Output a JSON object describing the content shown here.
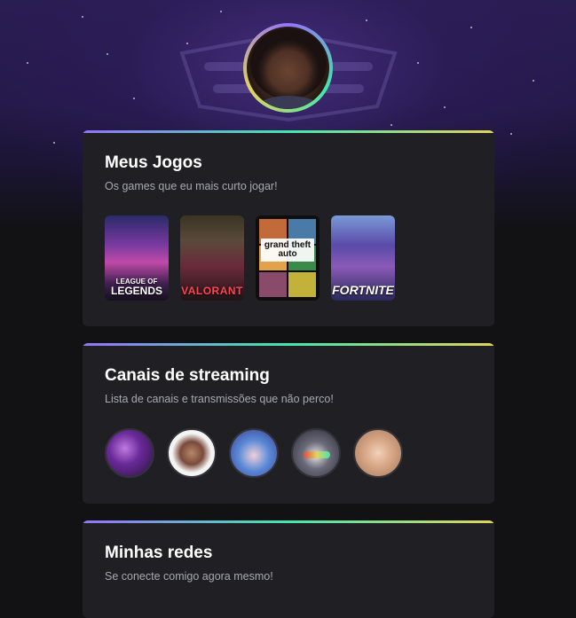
{
  "profile": {
    "avatar_alt": "Foto de perfil"
  },
  "games_card": {
    "title": "Meus Jogos",
    "subtitle": "Os games que eu mais curto jogar!",
    "games": [
      {
        "name": "LEAGUE OF LEGENDS",
        "line1": "LEAGUE OF",
        "line2": "LEGENDS"
      },
      {
        "name": "VALORANT"
      },
      {
        "name": "GRAND THEFT AUTO V",
        "label": "grand theft auto"
      },
      {
        "name": "FORTNITE"
      }
    ]
  },
  "streaming_card": {
    "title": "Canais de streaming",
    "subtitle": "Lista de canais e transmissões que não perco!",
    "channels": 5
  },
  "social_card": {
    "title": "Minhas redes",
    "subtitle": "Se conecte comigo agora mesmo!"
  },
  "colors": {
    "background": "#121214",
    "card": "#202024",
    "title": "#ffffff",
    "subtitle": "#a8a8b3",
    "gradient": [
      "#9572fc",
      "#43e7ad",
      "#e2d45c"
    ]
  }
}
